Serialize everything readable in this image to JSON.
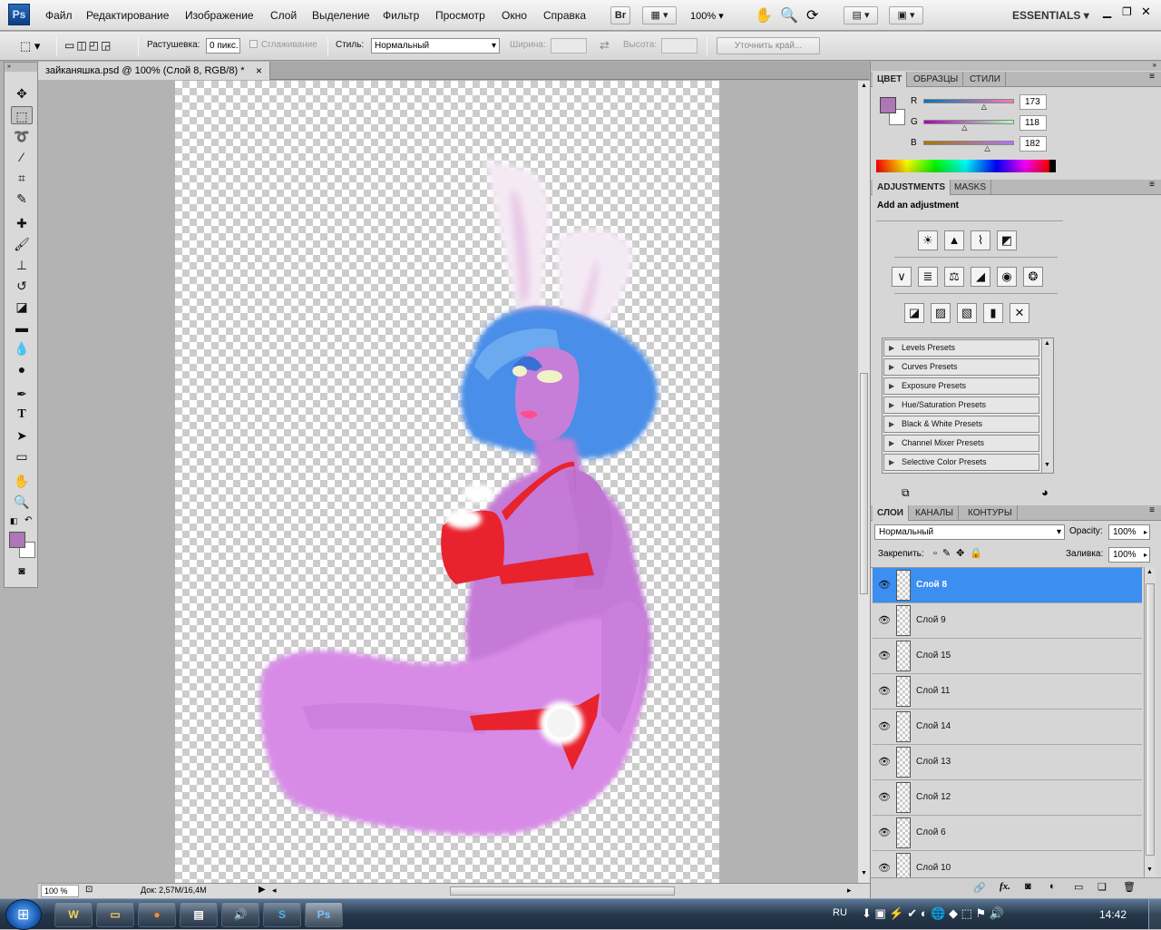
{
  "app": {
    "logo": "Ps"
  },
  "menu": [
    "Файл",
    "Редактирование",
    "Изображение",
    "Слой",
    "Выделение",
    "Фильтр",
    "Просмотр",
    "Окно",
    "Справка"
  ],
  "menubar_extras": {
    "bridge": "Br",
    "zoom": "100%",
    "workspace": "ESSENTIALS"
  },
  "options": {
    "feather_label": "Растушевка:",
    "feather_value": "0 пикс.",
    "antialias_label": "Сглаживание",
    "style_label": "Стиль:",
    "style_value": "Нормальный",
    "width_label": "Ширина:",
    "height_label": "Высота:",
    "refine_edge": "Уточнить край..."
  },
  "document": {
    "tab_title": "зайканяшка.psd @ 100% (Слой 8, RGB/8) *",
    "close": "×",
    "zoom": "100 %",
    "doc_size": "Док: 2,57M/16,4M"
  },
  "color_panel": {
    "tabs": [
      "ЦВЕТ",
      "ОБРАЗЦЫ",
      "СТИЛИ"
    ],
    "channels": [
      {
        "label": "R",
        "value": "173",
        "fraction": 0.678
      },
      {
        "label": "G",
        "value": "118",
        "fraction": 0.463
      },
      {
        "label": "B",
        "value": "182",
        "fraction": 0.714
      }
    ],
    "foreground": "#ad76b6",
    "background": "#ffffff"
  },
  "adjustments_panel": {
    "tabs": [
      "ADJUSTMENTS",
      "MASKS"
    ],
    "heading": "Add an adjustment",
    "icon_rows": [
      [
        "brightness-contrast-icon",
        "levels-icon",
        "curves-icon",
        "exposure-icon"
      ],
      [
        "vibrance-icon",
        "hue-saturation-icon",
        "color-balance-icon",
        "black-white-icon",
        "photo-filter-icon",
        "channel-mixer-icon"
      ],
      [
        "invert-icon",
        "posterize-icon",
        "threshold-icon",
        "gradient-map-icon",
        "selective-color-icon"
      ]
    ],
    "presets": [
      "Levels Presets",
      "Curves Presets",
      "Exposure Presets",
      "Hue/Saturation Presets",
      "Black & White Presets",
      "Channel Mixer Presets",
      "Selective Color Presets"
    ]
  },
  "layers_panel": {
    "tabs": [
      "СЛОИ",
      "КАНАЛЫ",
      "КОНТУРЫ"
    ],
    "blend_mode": "Нормальный",
    "opacity_label": "Opacity:",
    "opacity_value": "100%",
    "lock_label": "Закрепить:",
    "fill_label": "Заливка:",
    "fill_value": "100%",
    "layers": [
      {
        "name": "Слой 8",
        "selected": true
      },
      {
        "name": "Слой 9",
        "selected": false
      },
      {
        "name": "Слой 15",
        "selected": false
      },
      {
        "name": "Слой 11",
        "selected": false
      },
      {
        "name": "Слой 14",
        "selected": false
      },
      {
        "name": "Слой 13",
        "selected": false
      },
      {
        "name": "Слой 12",
        "selected": false
      },
      {
        "name": "Слой 6",
        "selected": false
      },
      {
        "name": "Слой 10",
        "selected": false
      }
    ],
    "footer_fx": "fx."
  },
  "taskbar": {
    "language": "RU",
    "clock": "14:42",
    "apps": [
      "W",
      "",
      "",
      " ",
      "S",
      "Ps"
    ]
  }
}
